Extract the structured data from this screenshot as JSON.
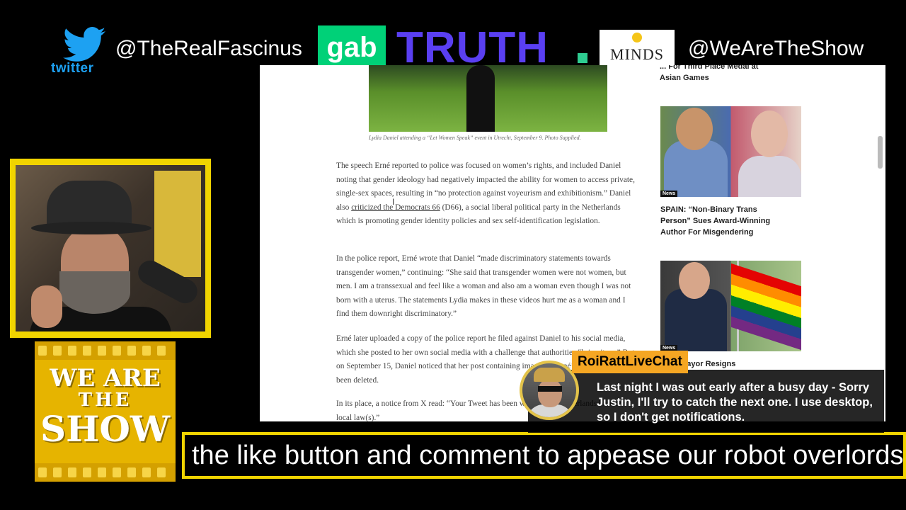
{
  "socials": {
    "twitter_word": "twitter",
    "handle_left": "@TheRealFascinus",
    "gab": "gab",
    "truth": "TRUTH",
    "minds": "MINDS",
    "handle_right": "@WeAreTheShow"
  },
  "article": {
    "caption": "Lydia Daniel attending a “Let Women Speak” event in Utrecht, September 9. Photo Supplied.",
    "p1_a": "The speech Erné reported to police was focused on women’s rights, and included Daniel noting that gender ideology had negatively impacted the ability for women to access private, single-sex spaces, resulting in “no protection against voyeurism and exhibitionism.” Daniel also ",
    "p1_link": "criticized the Democrats 66",
    "p1_b": " (D66), a social liberal political party in the Netherlands which is promoting gender identity policies and sex self-identification legislation.",
    "p2": "In the police report, Erné wrote that Daniel “made discriminatory statements towards transgender women,” continuing: “She said that transgender women were not women, but men. I am a transsexual and feel like a woman and also am a woman even though I was not born with a uterus. The statements Lydia makes in these videos hurt me as a woman and I find them downright discriminatory.”",
    "p3": "Erné later uploaded a copy of the police report he filed against Daniel to his social media, which she posted to her own social media with a challenge that authorities “bring it on.” But on September 15, Daniel noticed that her post containing images of Erné’s police report had been deleted.",
    "p4": "In its place, a notice from X read: “Your Tweet has been withheld in Netherlands based on local law(s).”",
    "side_prev_1": "... For Third Place Medal at",
    "side_prev_2": "Asian Games",
    "card1_tag": "News",
    "card1_title": "SPAIN: “Non-Binary Trans Person” Sues Award-Winning Author For Misgendering",
    "card2_tag": "News",
    "card2_title": "... ist Mayor Resigns"
  },
  "logo": {
    "line1": "WE ARE",
    "line2": "THE",
    "line3": "SHOW"
  },
  "ticker": {
    "text": "the like button and comment to appease our robot overlords"
  },
  "chat": {
    "username": "RoiRattLiveChat",
    "message": "Last night I was out early after a busy day - Sorry Justin, I'll try to catch the next one. I use desktop, so I don't get notifications."
  },
  "colors": {
    "accent_yellow": "#f1d400",
    "chat_name_bg": "#f5a623",
    "twitter_blue": "#1da1f2",
    "gab_green": "#00d178",
    "truth_purple": "#5a3ff2"
  }
}
